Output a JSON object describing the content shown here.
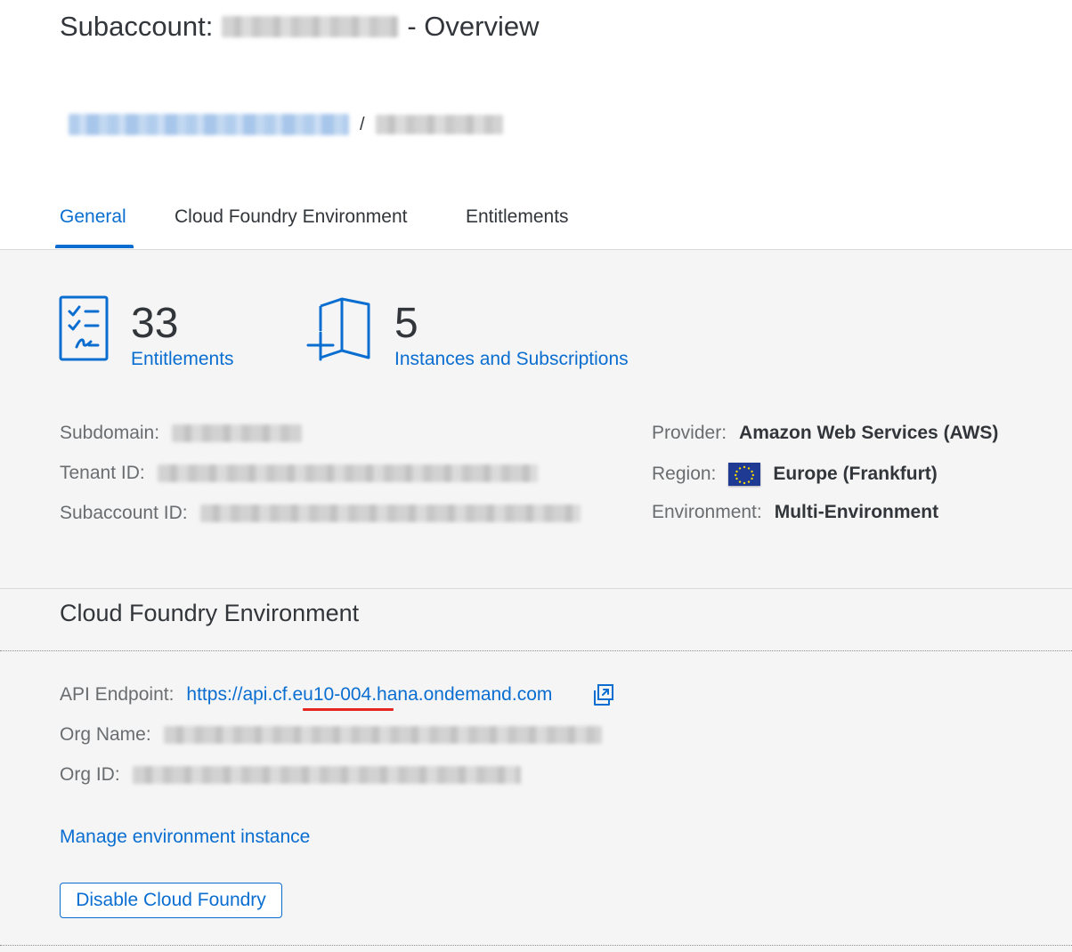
{
  "header": {
    "title_prefix": "Subaccount:",
    "title_suffix": "- Overview",
    "breadcrumb_separator": "/"
  },
  "tabs": [
    {
      "label": "General",
      "active": true
    },
    {
      "label": "Cloud Foundry Environment",
      "active": false
    },
    {
      "label": "Entitlements",
      "active": false
    }
  ],
  "stats": {
    "entitlements": {
      "count": "33",
      "label": "Entitlements",
      "icon": "entitlements-checklist-icon"
    },
    "instances": {
      "count": "5",
      "label": "Instances and Subscriptions",
      "icon": "instances-add-icon"
    }
  },
  "details": {
    "subdomain_label": "Subdomain:",
    "tenant_id_label": "Tenant ID:",
    "subaccount_id_label": "Subaccount ID:",
    "provider_label": "Provider:",
    "provider_value": "Amazon Web Services (AWS)",
    "region_label": "Region:",
    "region_value": "Europe (Frankfurt)",
    "region_flag_icon": "eu-flag-icon",
    "environment_label": "Environment:",
    "environment_value": "Multi-Environment"
  },
  "cf_section": {
    "title": "Cloud Foundry Environment",
    "api_endpoint_label": "API Endpoint:",
    "api_endpoint_value": "https://api.cf.eu10-004.hana.ondemand.com",
    "org_name_label": "Org Name:",
    "org_id_label": "Org ID:",
    "manage_link": "Manage environment instance",
    "disable_button": "Disable Cloud Foundry"
  },
  "colors": {
    "accent": "#0a6ed1",
    "highlight_underline": "#e5261f",
    "text": "#32363a",
    "label": "#6a6d70"
  }
}
